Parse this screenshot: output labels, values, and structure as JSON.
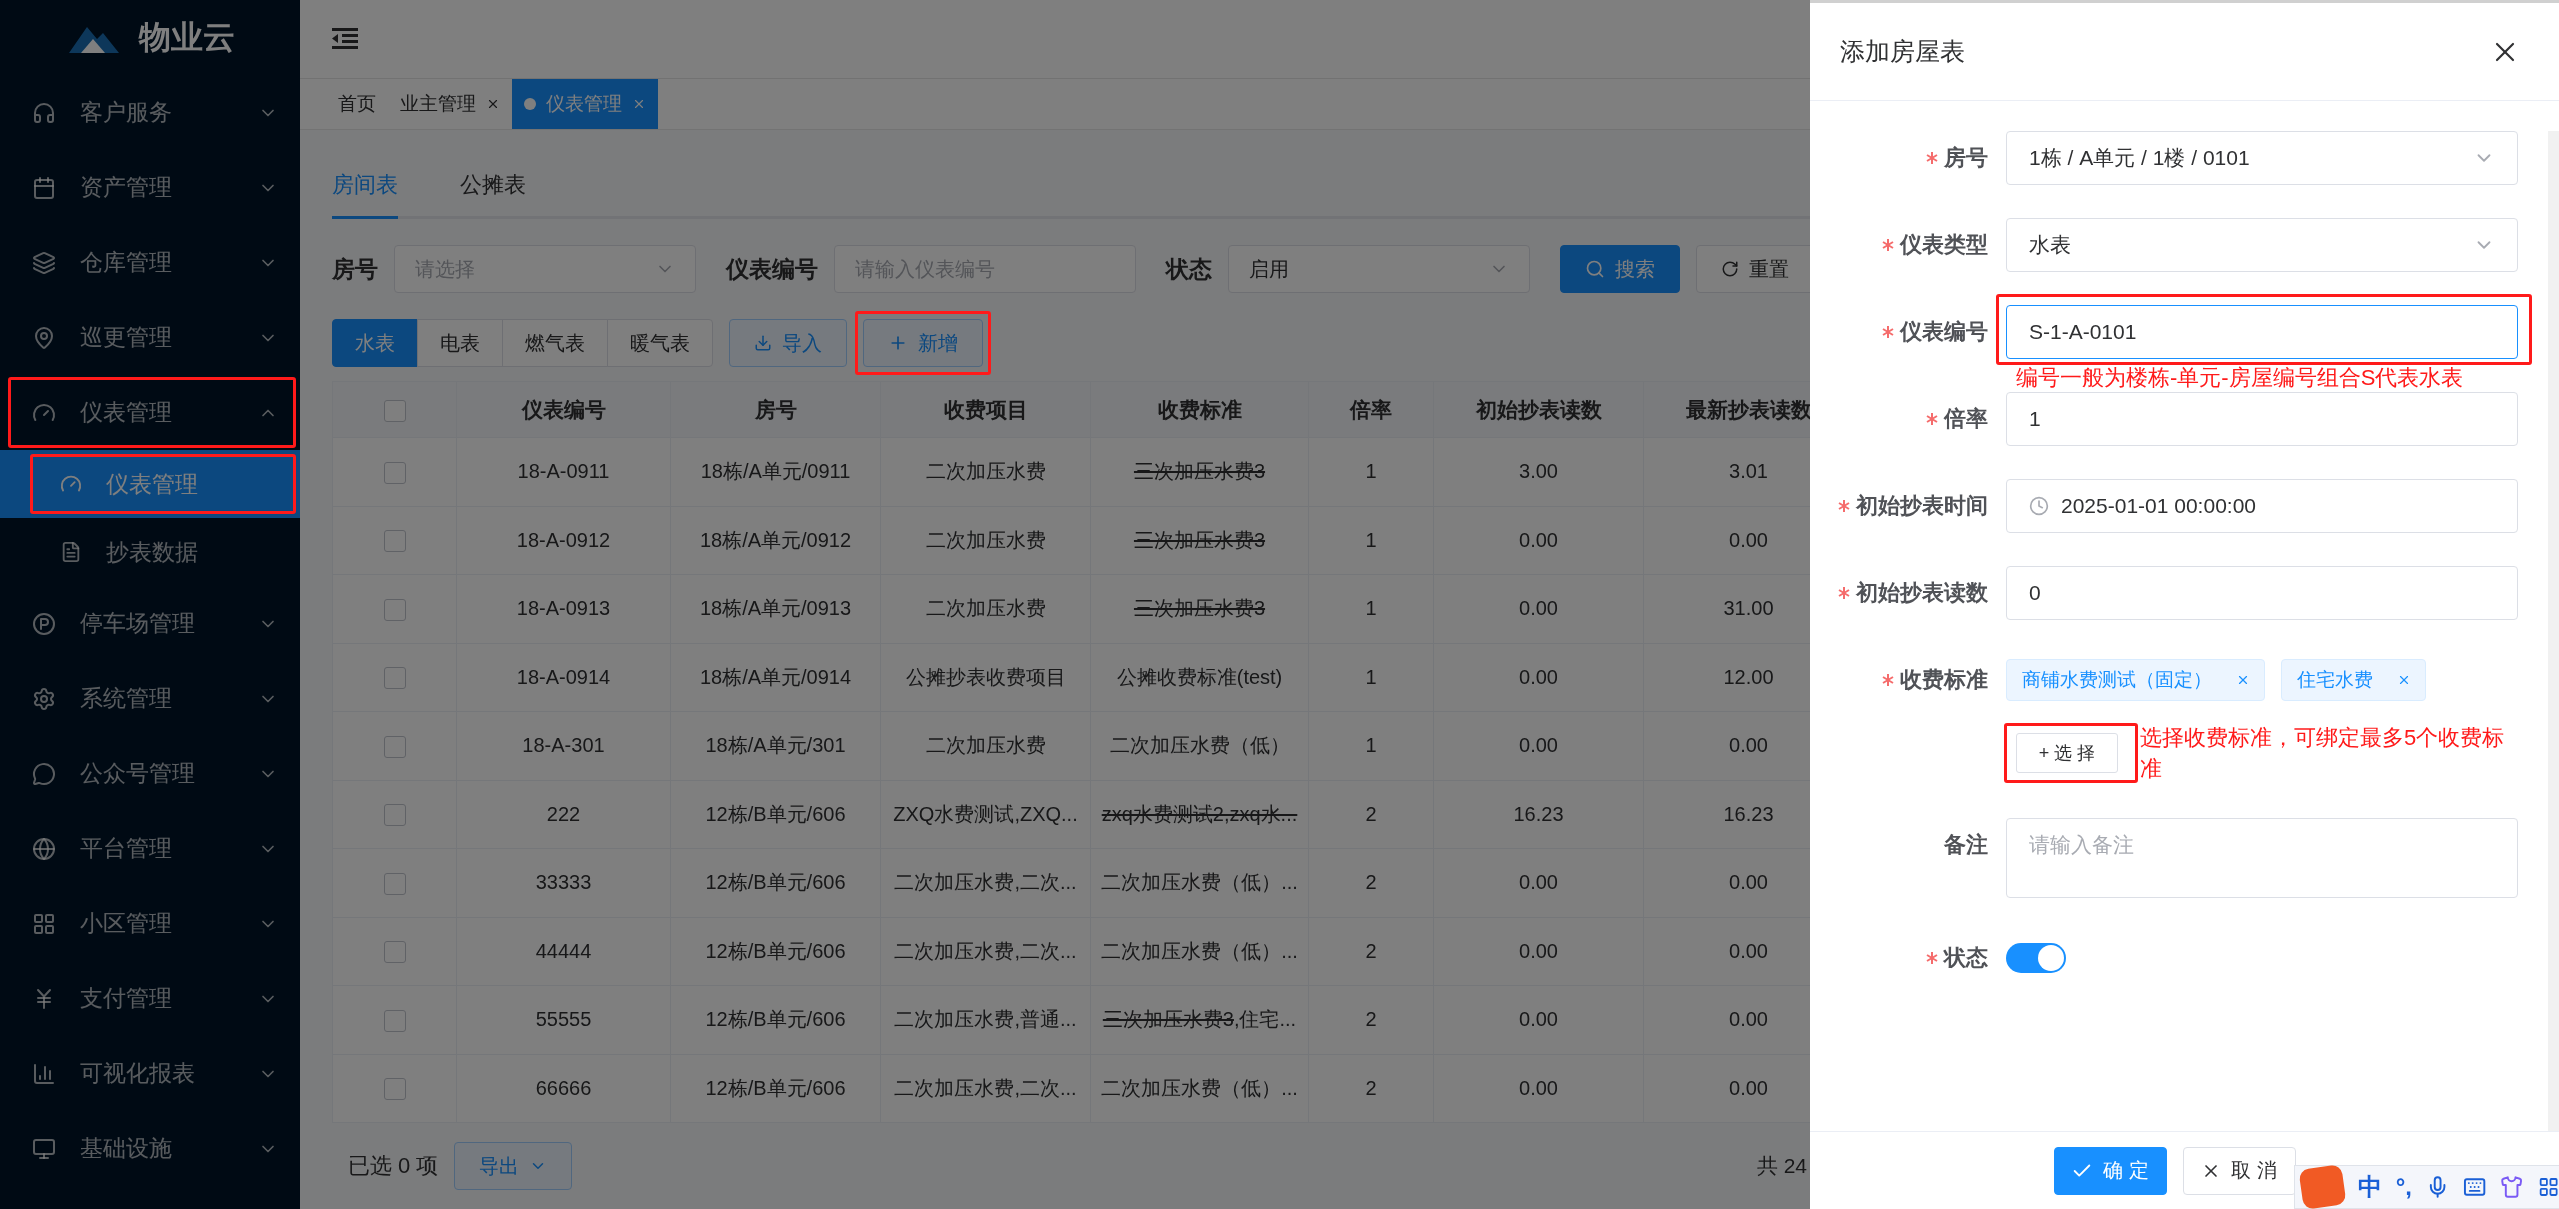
{
  "sidebar": {
    "logo": "物业云",
    "items": [
      {
        "label": "客户服务",
        "expanded": false,
        "annotated": false
      },
      {
        "label": "资产管理",
        "expanded": false,
        "annotated": false
      },
      {
        "label": "仓库管理",
        "expanded": false,
        "annotated": false
      },
      {
        "label": "巡更管理",
        "expanded": false,
        "annotated": false
      },
      {
        "label": "仪表管理",
        "expanded": true,
        "annotated": true,
        "children": [
          {
            "label": "仪表管理",
            "selected": true,
            "annotated": true
          },
          {
            "label": "抄表数据",
            "selected": false,
            "annotated": false
          }
        ]
      },
      {
        "label": "停车场管理",
        "expanded": false,
        "annotated": false
      },
      {
        "label": "系统管理",
        "expanded": false,
        "annotated": false
      },
      {
        "label": "公众号管理",
        "expanded": false,
        "annotated": false
      },
      {
        "label": "平台管理",
        "expanded": false,
        "annotated": false
      },
      {
        "label": "小区管理",
        "expanded": false,
        "annotated": false
      },
      {
        "label": "支付管理",
        "expanded": false,
        "annotated": false
      },
      {
        "label": "可视化报表",
        "expanded": false,
        "annotated": false
      },
      {
        "label": "基础设施",
        "expanded": false,
        "annotated": false
      }
    ]
  },
  "tags": [
    {
      "label": "首页",
      "selected": false,
      "closable": false
    },
    {
      "label": "业主管理",
      "selected": false,
      "closable": true
    },
    {
      "label": "仪表管理",
      "selected": true,
      "closable": true
    }
  ],
  "tabs": [
    {
      "label": "房间表",
      "selected": true
    },
    {
      "label": "公摊表",
      "selected": false
    }
  ],
  "filters": [
    {
      "kind": "select",
      "label": "房号",
      "placeholder": "请选择"
    },
    {
      "kind": "input",
      "label": "仪表编号",
      "placeholder": "请输入仪表编号"
    },
    {
      "kind": "select",
      "label": "状态",
      "value": "启用"
    }
  ],
  "search_button": "搜索",
  "reset_button": "重置",
  "meter_types": [
    {
      "label": "水表",
      "selected": true
    },
    {
      "label": "电表",
      "selected": false
    },
    {
      "label": "燃气表",
      "selected": false
    },
    {
      "label": "暖气表",
      "selected": false
    }
  ],
  "import_button": "导入",
  "add_button": {
    "label": "新增",
    "annotated": true
  },
  "table": {
    "select_all": {
      "checked": false
    },
    "columns": [
      "仪表编号",
      "房号",
      "收费项目",
      "收费标准",
      "倍率",
      "初始抄表读数",
      "最新抄表读数"
    ],
    "rows": [
      {
        "checked": false,
        "meter_no": "18-A-0911",
        "room": "18栋/A单元/0911",
        "item": "二次加压水费",
        "standard": [
          {
            "text": "三次加压水费3",
            "struck": true
          }
        ],
        "multiplier": "1",
        "initial": "3.00",
        "latest": "3.01"
      },
      {
        "checked": false,
        "meter_no": "18-A-0912",
        "room": "18栋/A单元/0912",
        "item": "二次加压水费",
        "standard": [
          {
            "text": "三次加压水费3",
            "struck": true
          }
        ],
        "multiplier": "1",
        "initial": "0.00",
        "latest": "0.00"
      },
      {
        "checked": false,
        "meter_no": "18-A-0913",
        "room": "18栋/A单元/0913",
        "item": "二次加压水费",
        "standard": [
          {
            "text": "三次加压水费3",
            "struck": true
          }
        ],
        "multiplier": "1",
        "initial": "0.00",
        "latest": "31.00"
      },
      {
        "checked": false,
        "meter_no": "18-A-0914",
        "room": "18栋/A单元/0914",
        "item": "公摊抄表收费项目",
        "standard": [
          {
            "text": "公摊收费标准(test)",
            "struck": false
          }
        ],
        "multiplier": "1",
        "initial": "0.00",
        "latest": "12.00"
      },
      {
        "checked": false,
        "meter_no": "18-A-301",
        "room": "18栋/A单元/301",
        "item": "二次加压水费",
        "standard": [
          {
            "text": "二次加压水费（低）",
            "struck": false
          }
        ],
        "multiplier": "1",
        "initial": "0.00",
        "latest": "0.00"
      },
      {
        "checked": false,
        "meter_no": "222",
        "room": "12栋/B单元/606",
        "item": "ZXQ水费测试,ZXQ...",
        "standard": [
          {
            "text": "zxq水费测试2,zxq水...",
            "struck": true
          }
        ],
        "multiplier": "2",
        "initial": "16.23",
        "latest": "16.23"
      },
      {
        "checked": false,
        "meter_no": "33333",
        "room": "12栋/B单元/606",
        "item": "二次加压水费,二次...",
        "standard": [
          {
            "text": "二次加压水费（低）...",
            "struck": false
          }
        ],
        "multiplier": "2",
        "initial": "0.00",
        "latest": "0.00"
      },
      {
        "checked": false,
        "meter_no": "44444",
        "room": "12栋/B单元/606",
        "item": "二次加压水费,二次...",
        "standard": [
          {
            "text": "二次加压水费（低）...",
            "struck": false
          }
        ],
        "multiplier": "2",
        "initial": "0.00",
        "latest": "0.00"
      },
      {
        "checked": false,
        "meter_no": "55555",
        "room": "12栋/B单元/606",
        "item": "二次加压水费,普通...",
        "standard": [
          {
            "text": "三次加压水费3",
            "struck": true
          },
          {
            "text": ",住宅...",
            "struck": false
          }
        ],
        "multiplier": "2",
        "initial": "0.00",
        "latest": "0.00"
      },
      {
        "checked": false,
        "meter_no": "66666",
        "room": "12栋/B单元/606",
        "item": "二次加压水费,二次...",
        "standard": [
          {
            "text": "二次加压水费（低）...",
            "struck": false
          }
        ],
        "multiplier": "2",
        "initial": "0.00",
        "latest": "0.00"
      }
    ]
  },
  "footer": {
    "selected_count": "已选 0 项",
    "export_button": "导出",
    "total": "共 24"
  },
  "drawer": {
    "title": "添加房屋表",
    "fields": [
      {
        "kind": "select",
        "label": "房号",
        "required": true,
        "value": "1栋 / A单元 / 1楼 / 0101"
      },
      {
        "kind": "select",
        "label": "仪表类型",
        "required": true,
        "value": "水表"
      },
      {
        "kind": "input",
        "label": "仪表编号",
        "required": true,
        "value": "S-1-A-0101",
        "focused": true,
        "annotated": true,
        "note": "编号一般为楼栋-单元-房屋编号组合S代表水表"
      },
      {
        "kind": "input",
        "label": "倍率",
        "required": true,
        "value": "1"
      },
      {
        "kind": "datetime",
        "label": "初始抄表时间",
        "required": true,
        "value": "2025-01-01 00:00:00"
      },
      {
        "kind": "input",
        "label": "初始抄表读数",
        "required": true,
        "value": "0"
      },
      {
        "kind": "tags",
        "label": "收费标准",
        "required": true,
        "tags": [
          "商铺水费测试（固定）",
          "住宅水费"
        ],
        "button": "+ 选 择",
        "annotated": true,
        "note": "选择收费标准，可绑定最多5个收费标准"
      },
      {
        "kind": "textarea",
        "label": "备注",
        "required": false,
        "placeholder": "请输入备注"
      },
      {
        "kind": "switch",
        "label": "状态",
        "required": true,
        "on": true
      }
    ],
    "confirm_button": "确 定",
    "cancel_button": "取 消"
  },
  "ime": {
    "language": "中",
    "punctuation": "°,"
  }
}
